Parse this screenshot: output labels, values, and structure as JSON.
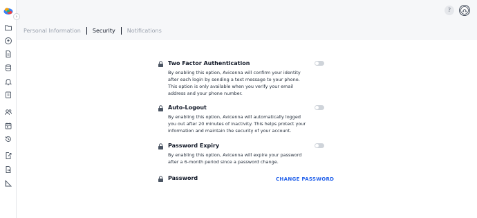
{
  "app": {
    "help_label": "?"
  },
  "sidebar": {
    "collapse_label": "›",
    "icons": [
      "folder-icon",
      "cloud-upload-icon",
      "document-icon",
      "database-icon",
      "bell-icon",
      "clipboard-icon",
      "users-icon",
      "calendar-icon",
      "history-icon",
      "file-export-icon",
      "file-import-icon",
      "ruler-icon"
    ]
  },
  "tabs": [
    {
      "label": "Personal Information",
      "active": false
    },
    {
      "label": "Security",
      "active": true
    },
    {
      "label": "Notifications",
      "active": false
    }
  ],
  "security": {
    "settings": [
      {
        "title": "Two Factor Authentication",
        "description": "By enabling this option, Avicenna will confirm your identity after each login by sending a text message to your phone.\nThis option is only available when you verify your email address and your phone number.",
        "enabled": false
      },
      {
        "title": "Auto-Logout",
        "description": "By enabling this option, Avicenna will automatically logged you out after 20 minutes of inactivity. This helps protect your information and maintain the security of your account.",
        "enabled": false
      },
      {
        "title": "Password Expiry",
        "description": "By enabling this option, Avicenna will expire your password after a 6-month period since a password change.",
        "enabled": false
      }
    ],
    "password": {
      "title": "Password",
      "action_label": "CHANGE PASSWORD"
    }
  },
  "colors": {
    "accent": "#2563eb",
    "toggle_off": "#cfd4da",
    "lock": "#4b5563"
  }
}
